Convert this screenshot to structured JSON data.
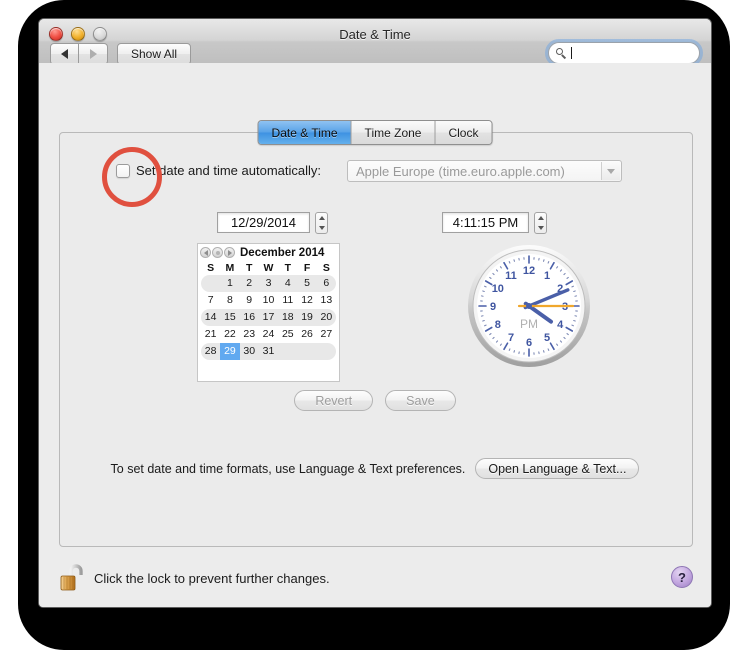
{
  "window": {
    "title": "Date & Time",
    "traffic_lights": [
      "close-button",
      "minimize-button",
      "zoom-button"
    ]
  },
  "toolbar": {
    "back_label": "◀",
    "forward_label": "▶",
    "show_all_label": "Show All",
    "search": {
      "value": "",
      "placeholder": "",
      "icon": "search-icon"
    }
  },
  "tabs": [
    {
      "label": "Date & Time",
      "active": true
    },
    {
      "label": "Time Zone",
      "active": false
    },
    {
      "label": "Clock",
      "active": false
    }
  ],
  "auto": {
    "checkbox_checked": false,
    "label": "Set date and time automatically:",
    "server_value": "Apple Europe (time.euro.apple.com)",
    "server_disabled": true
  },
  "date_field": {
    "value": "12/29/2014",
    "stepper": "date-stepper"
  },
  "time_field": {
    "value": "4:11:15 PM",
    "stepper": "time-stepper"
  },
  "calendar": {
    "month_label": "December 2014",
    "weekdays": [
      "S",
      "M",
      "T",
      "W",
      "T",
      "F",
      "S"
    ],
    "weeks": [
      [
        "",
        "1",
        "2",
        "3",
        "4",
        "5",
        "6"
      ],
      [
        "7",
        "8",
        "9",
        "10",
        "11",
        "12",
        "13"
      ],
      [
        "14",
        "15",
        "16",
        "17",
        "18",
        "19",
        "20"
      ],
      [
        "21",
        "22",
        "23",
        "24",
        "25",
        "26",
        "27"
      ],
      [
        "28",
        "29",
        "30",
        "31",
        "",
        "",
        ""
      ]
    ],
    "selected_day": "29",
    "nav": [
      "prev-month",
      "today",
      "next-month"
    ]
  },
  "clock": {
    "meridiem": "PM",
    "hour": 4,
    "minute": 11,
    "second": 15,
    "numerals": [
      "12",
      "1",
      "2",
      "3",
      "4",
      "5",
      "6",
      "7",
      "8",
      "9",
      "10",
      "11"
    ],
    "hand_color": "#4a5fa8",
    "second_hand_color": "#f0a72c"
  },
  "actions": {
    "revert_label": "Revert",
    "revert_disabled": true,
    "save_label": "Save",
    "save_disabled": true
  },
  "formats": {
    "text": "To set date and time formats, use Language & Text preferences.",
    "button_label": "Open Language & Text..."
  },
  "lock": {
    "icon": "unlocked-padlock-icon",
    "text": "Click the lock to prevent further changes."
  },
  "help": {
    "label": "?"
  },
  "annotation": {
    "type": "red-circle-highlight",
    "color": "#e0503f",
    "target": "set-date-time-automatically-checkbox"
  }
}
